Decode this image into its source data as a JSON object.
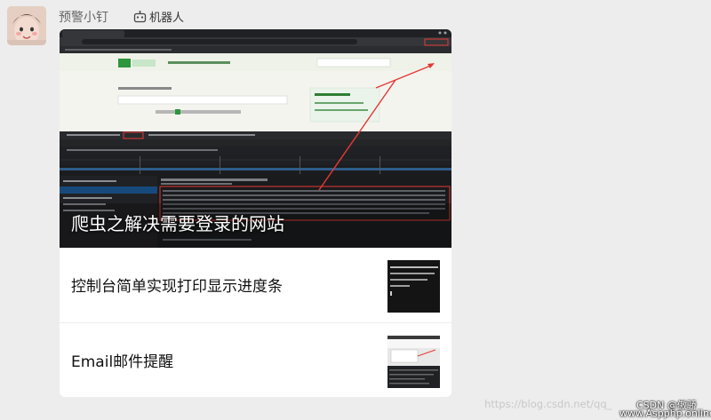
{
  "chat": {
    "sender_name": "预警小钉",
    "badge_label": "机器人",
    "badge_icon": "robot-icon"
  },
  "card": {
    "main_title": "爬虫之解决需要登录的网站",
    "items": [
      {
        "title": "控制台简单实现打印显示进度条",
        "thumb": "console-terminal-thumbnail"
      },
      {
        "title": "Email邮件提醒",
        "thumb": "browser-devtools-thumbnail"
      }
    ]
  },
  "watermarks": {
    "blog_url": "https://blog.csdn.net/qq_",
    "csdn_author": "CSDN @傲骄",
    "site": "www.Aspphp.online"
  },
  "colors": {
    "chat_background": "#ededed",
    "card_background": "#ffffff",
    "highlight_red": "#e53935",
    "douban_green": "#2e963d"
  }
}
